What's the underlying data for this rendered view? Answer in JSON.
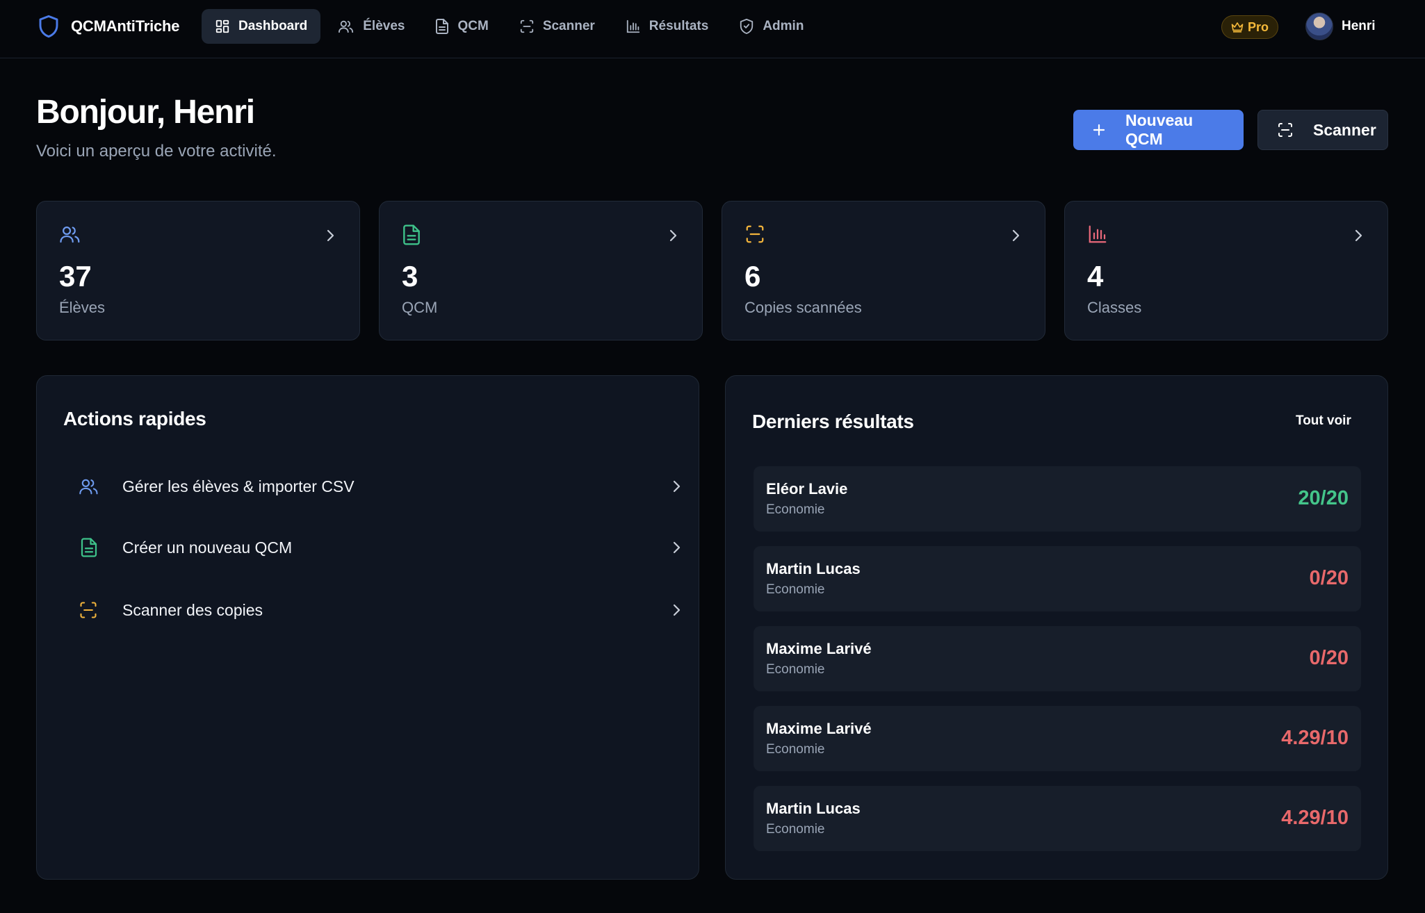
{
  "brand": {
    "name": "QCMAntiTriche",
    "icon": "shield-icon"
  },
  "nav": [
    {
      "label": "Dashboard",
      "icon": "dashboard-grid-icon",
      "active": true
    },
    {
      "label": "Élèves",
      "icon": "users-icon",
      "active": false
    },
    {
      "label": "QCM",
      "icon": "document-icon",
      "active": false
    },
    {
      "label": "Scanner",
      "icon": "scan-icon",
      "active": false
    },
    {
      "label": "Résultats",
      "icon": "bar-chart-icon",
      "active": false
    },
    {
      "label": "Admin",
      "icon": "shield-check-icon",
      "active": false
    }
  ],
  "badge": {
    "label": "Pro",
    "icon": "crown-icon"
  },
  "user": {
    "name": "Henri"
  },
  "header": {
    "greeting": "Bonjour, Henri",
    "subtitle": "Voici un aperçu de votre activité.",
    "primary_button": "Nouveau QCM",
    "secondary_button": "Scanner"
  },
  "stats": [
    {
      "value": "37",
      "label": "Élèves",
      "icon": "users-icon",
      "color": "#6f9cf0"
    },
    {
      "value": "3",
      "label": "QCM",
      "icon": "document-icon",
      "color": "#3ec28a"
    },
    {
      "value": "6",
      "label": "Copies scannées",
      "icon": "scan-icon",
      "color": "#f2b43c"
    },
    {
      "value": "4",
      "label": "Classes",
      "icon": "bar-chart-icon",
      "color": "#e8687a"
    }
  ],
  "quick_actions": {
    "title": "Actions rapides",
    "items": [
      {
        "label": "Gérer les élèves & importer CSV",
        "icon": "users-icon",
        "color": "#6f9cf0"
      },
      {
        "label": "Créer un nouveau QCM",
        "icon": "document-icon",
        "color": "#3ec28a"
      },
      {
        "label": "Scanner des copies",
        "icon": "scan-icon",
        "color": "#f2b43c"
      }
    ]
  },
  "results": {
    "title": "Derniers résultats",
    "see_all": "Tout voir",
    "rows": [
      {
        "name": "Eléor Lavie",
        "subject": "Economie",
        "score": "20/20",
        "status": "pass"
      },
      {
        "name": "Martin Lucas",
        "subject": "Economie",
        "score": "0/20",
        "status": "fail"
      },
      {
        "name": "Maxime Larivé",
        "subject": "Economie",
        "score": "0/20",
        "status": "fail"
      },
      {
        "name": "Maxime Larivé",
        "subject": "Economie",
        "score": "4.29/10",
        "status": "fail"
      },
      {
        "name": "Martin Lucas",
        "subject": "Economie",
        "score": "4.29/10",
        "status": "fail"
      }
    ]
  },
  "colors": {
    "accent": "#4b7be8",
    "score_pass": "#44c58a",
    "score_fail": "#e8696b",
    "pro": "#f5b93a"
  }
}
